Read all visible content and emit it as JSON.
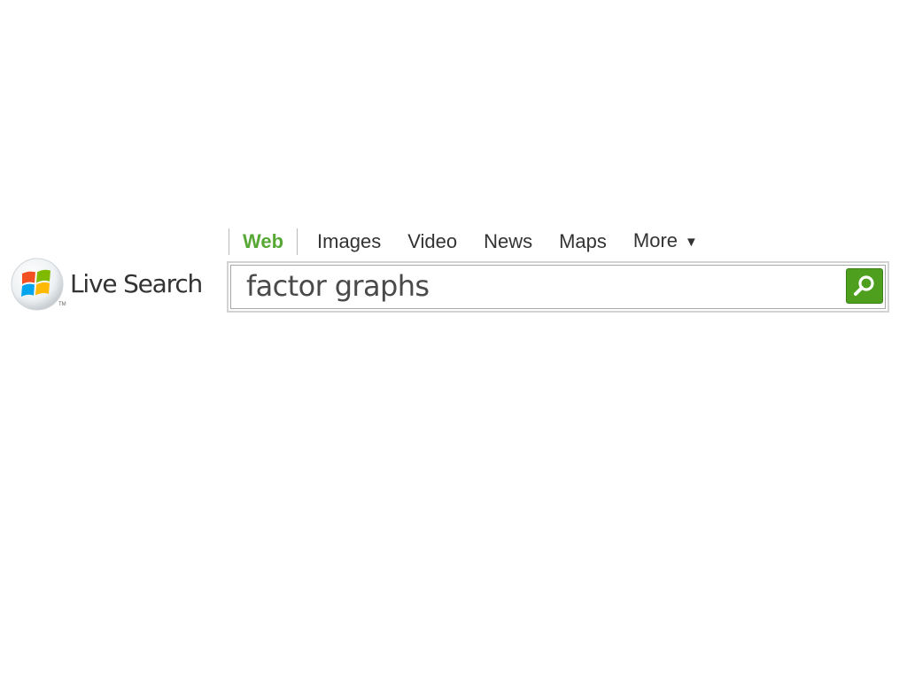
{
  "logo": {
    "text": "Live Search",
    "trademark": "TM",
    "icon": "windows-flag-icon"
  },
  "tabs": [
    {
      "label": "Web",
      "active": true
    },
    {
      "label": "Images",
      "active": false
    },
    {
      "label": "Video",
      "active": false
    },
    {
      "label": "News",
      "active": false
    },
    {
      "label": "Maps",
      "active": false
    },
    {
      "label": "More",
      "active": false,
      "caret": "▼"
    }
  ],
  "search": {
    "value": "factor graphs",
    "button_icon": "search-icon"
  },
  "colors": {
    "active_tab": "#58a836",
    "search_button": "#4f9f1f"
  }
}
